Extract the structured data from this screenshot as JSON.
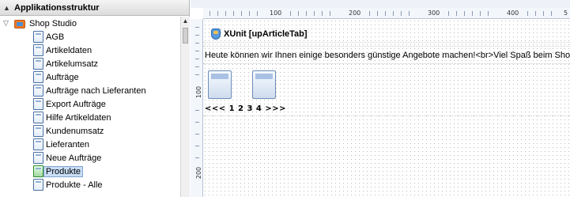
{
  "left_panel": {
    "title": "Applikationsstruktur",
    "tree": {
      "root_label": "Shop Studio",
      "items": [
        {
          "label": "AGB"
        },
        {
          "label": "Artikeldaten"
        },
        {
          "label": "Artikelumsatz"
        },
        {
          "label": "Aufträge"
        },
        {
          "label": "Aufträge nach Lieferanten"
        },
        {
          "label": "Export Aufträge"
        },
        {
          "label": "Hilfe Artikeldaten"
        },
        {
          "label": "Kundenumsatz"
        },
        {
          "label": "Lieferanten"
        },
        {
          "label": "Neue Aufträge"
        },
        {
          "label": "Produkte",
          "selected": true
        },
        {
          "label": "Produkte - Alle"
        }
      ]
    }
  },
  "designer": {
    "ruler": {
      "h_labels": [
        "100",
        "200",
        "300",
        "400",
        "5"
      ],
      "v_labels": [
        "100",
        "200"
      ]
    },
    "component_title": "XUnit [upArticleTab]",
    "text_content": "Heute können wir Ihnen einige besonders günstige Angebote machen!<br>Viel Spaß beim Shoppen.",
    "pager_text": "<<< 1 2 3 4 >>>"
  }
}
